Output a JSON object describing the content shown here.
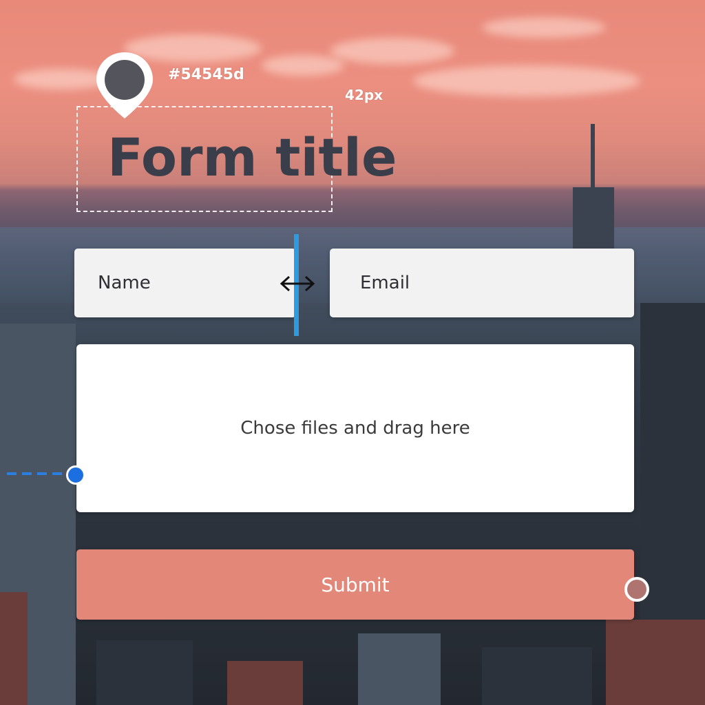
{
  "annotations": {
    "color_label": "#54545d",
    "size_label": "42px"
  },
  "form": {
    "title": "Form title",
    "title_color": "#54545d",
    "name_placeholder": "Name",
    "email_placeholder": "Email",
    "dropzone_text": "Chose files and drag here",
    "submit_label": "Submit",
    "submit_color": "#e38878"
  },
  "icons": {
    "pin": "location-pin-icon",
    "resize": "resize-horizontal-icon"
  }
}
